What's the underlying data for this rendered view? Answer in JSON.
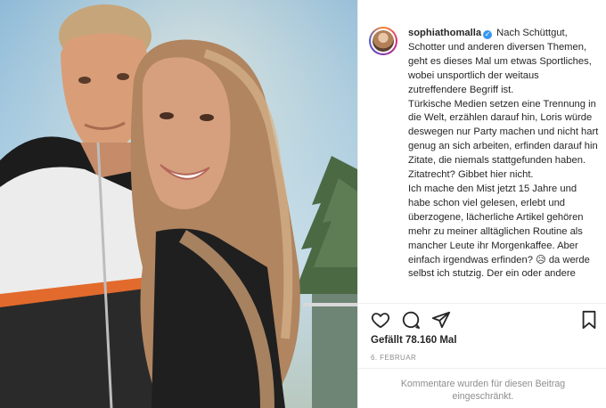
{
  "post": {
    "username": "sophiathomalla",
    "verified_glyph": "✓",
    "caption_lines": [
      " Nach Schüttgut, Schotter und anderen diversen Themen, geht es dieses Mal um etwas Sportliches, wobei unsportlich der weitaus zutreffendere Begriff ist.",
      "Türkische Medien setzen eine Trennung in die Welt, erzählen darauf hin, Loris würde deswegen nur Party machen und nicht hart genug an sich arbeiten, erfinden darauf hin Zitate, die niemals stattgefunden haben.",
      "Zitatrecht? Gibbet hier nicht.",
      "Ich mache den Mist jetzt 15 Jahre und habe schon viel gelesen, erlebt und überzogene, lächerliche Artikel gehören mehr zu meiner alltäglichen Routine als mancher Leute ihr Morgenkaffee. Aber einfach irgendwas erfinden? 😥 da werde selbst ich stutzig. Der ein oder andere"
    ],
    "likes": "Gefällt 78.160 Mal",
    "date": "6. FEBRUAR",
    "comments_notice": "Kommentare wurden für diesen Beitrag eingeschränkt."
  },
  "icons": {
    "like": "heart-icon",
    "comment": "comment-icon",
    "share": "share-icon",
    "save": "bookmark-icon"
  },
  "colors": {
    "verified": "#3897f0",
    "text": "#262626",
    "muted": "#8e8e8e",
    "divider": "#efefef"
  }
}
